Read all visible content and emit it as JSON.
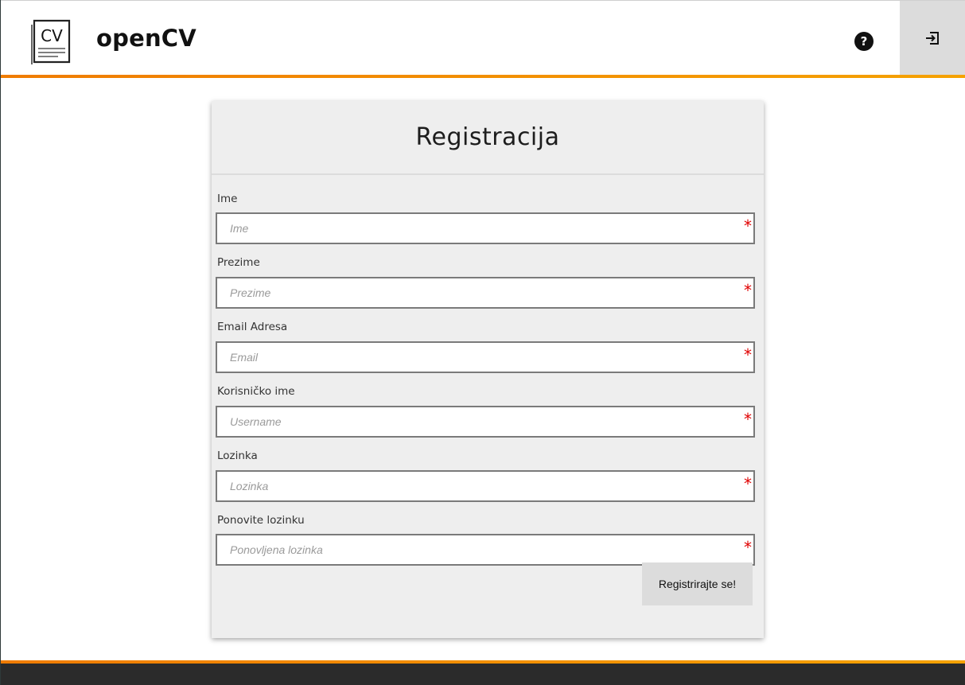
{
  "header": {
    "logo_text": "CV",
    "app_title": "openCV",
    "help_icon": "question-circle-icon",
    "login_icon": "sign-in-icon"
  },
  "form": {
    "title": "Registracija",
    "fields": [
      {
        "label": "Ime",
        "placeholder": "Ime",
        "value": "",
        "required_mark": "*"
      },
      {
        "label": "Prezime",
        "placeholder": "Prezime",
        "value": "",
        "required_mark": "*"
      },
      {
        "label": "Email Adresa",
        "placeholder": "Email",
        "value": "",
        "required_mark": "*"
      },
      {
        "label": "Korisničko ime",
        "placeholder": "Username",
        "value": "",
        "required_mark": "*"
      },
      {
        "label": "Lozinka",
        "placeholder": "Lozinka",
        "value": "",
        "required_mark": "*"
      },
      {
        "label": "Ponovite lozinku",
        "placeholder": "Ponovljena lozinka",
        "value": "",
        "required_mark": "*"
      }
    ],
    "submit_label": "Registrirajte se!"
  },
  "colors": {
    "accent_orange": "#f07c00",
    "accent_yellow": "#f5a200",
    "required_red": "#e00000",
    "footer_dark": "#2b2b2b",
    "card_bg": "#eeeeee"
  }
}
